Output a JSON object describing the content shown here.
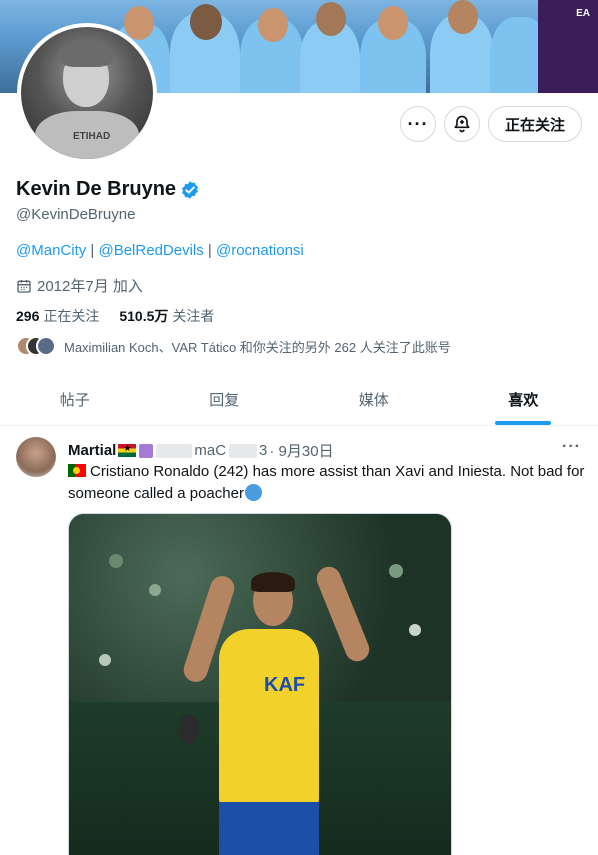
{
  "banner": {
    "sponsor_label": "EA"
  },
  "profile": {
    "display_name": "Kevin De Bruyne",
    "handle": "@KevinDeBruyne",
    "bio_links": [
      "@ManCity",
      "@BelRedDevils",
      "@rocnationsi"
    ],
    "bio_separator": " | ",
    "joined": "2012年7月 加入",
    "following_count": "296",
    "following_label": "正在关注",
    "followers_count": "510.5万",
    "followers_label": "关注者",
    "followed_by_text": "Maximilian Koch、VAR Tático 和你关注的另外 262 人关注了此账号",
    "avatar_shirt_text": "ETIHAD"
  },
  "actions": {
    "more_label": "···",
    "follow_label": "正在关注"
  },
  "tabs": [
    {
      "label": "帖子",
      "active": false
    },
    {
      "label": "回复",
      "active": false
    },
    {
      "label": "媒体",
      "active": false
    },
    {
      "label": "喜欢",
      "active": true
    }
  ],
  "tweet": {
    "author": "Martial",
    "handle_partial": "maC",
    "handle_suffix": "3",
    "date": "· 9月30日",
    "more_label": "···",
    "text": "Cristiano Ronaldo (242) has more assist than Xavi and Iniesta. Not bad for someone called a poacher",
    "media_shirt_text": "KAF"
  },
  "colors": {
    "accent": "#1d9bf0",
    "secondary_text": "#536471",
    "primary_text": "#0f1419",
    "border": "#cfd9de"
  }
}
